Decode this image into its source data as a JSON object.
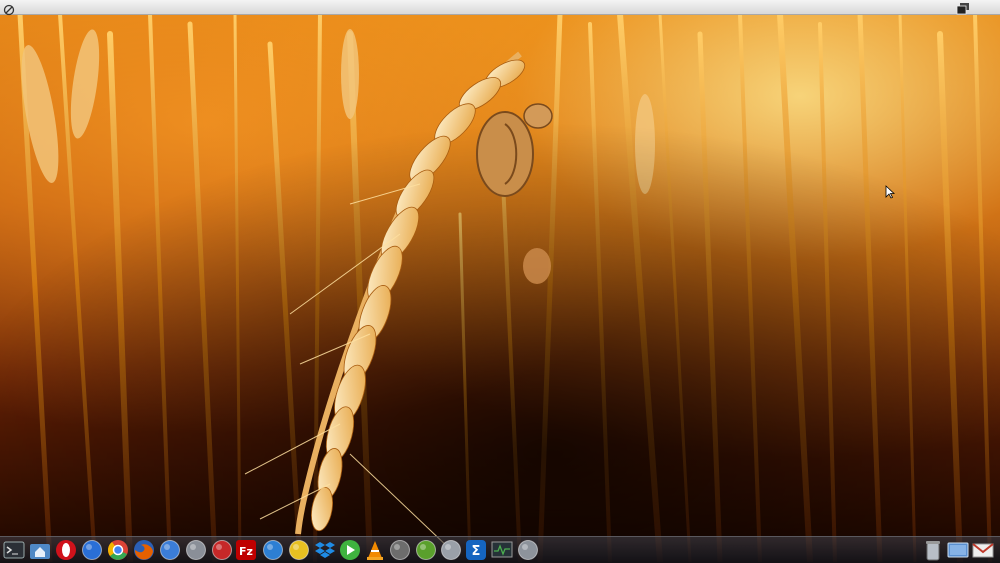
{
  "topbar": {
    "left_icon": "app-menu-icon",
    "right_icon": "window-switcher-icon"
  },
  "desktop": {
    "wallpaper": "wheat-field-sunset"
  },
  "dock": {
    "items": [
      {
        "icon": "terminal-icon",
        "color": "#2b2f36"
      },
      {
        "icon": "home-folder-icon",
        "color": "#4f88c6"
      },
      {
        "icon": "opera-icon",
        "color": "#d0121b"
      },
      {
        "icon": "network-globe-icon",
        "color": "#2a6fd6"
      },
      {
        "icon": "chrome-icon",
        "color": "#34a853"
      },
      {
        "icon": "firefox-icon",
        "color": "#e66000"
      },
      {
        "icon": "mail-icon",
        "color": "#3b7dd8"
      },
      {
        "icon": "scanner-icon",
        "color": "#8a8f98"
      },
      {
        "icon": "media-ball-icon",
        "color": "#c62828"
      },
      {
        "icon": "filezilla-icon",
        "color": "#bf0000",
        "label": "Fz"
      },
      {
        "icon": "cloud-info-icon",
        "color": "#2d7fd3"
      },
      {
        "icon": "banana-icon",
        "color": "#e8c021"
      },
      {
        "icon": "dropbox-icon",
        "color": "#1f8ce6"
      },
      {
        "icon": "play-icon",
        "color": "#3fb33f"
      },
      {
        "icon": "vlc-icon",
        "color": "#f28a00"
      },
      {
        "icon": "game-controller-icon",
        "color": "#6d6d6d"
      },
      {
        "icon": "pidgin-icon",
        "color": "#5aa02c"
      },
      {
        "icon": "download-tray-icon",
        "color": "#9aa0a8"
      },
      {
        "icon": "update-manager-icon",
        "color": "#1565c0",
        "label": "Σ"
      },
      {
        "icon": "system-monitor-icon",
        "color": "#263238"
      },
      {
        "icon": "settings-tools-icon",
        "color": "#8d939b"
      }
    ],
    "right_items": [
      {
        "icon": "trash-icon",
        "color": "#b8bec6"
      },
      {
        "icon": "show-desktop-icon",
        "color": "#5a8fd0"
      },
      {
        "icon": "mail-unread-icon",
        "color": "#c0392b"
      }
    ]
  }
}
